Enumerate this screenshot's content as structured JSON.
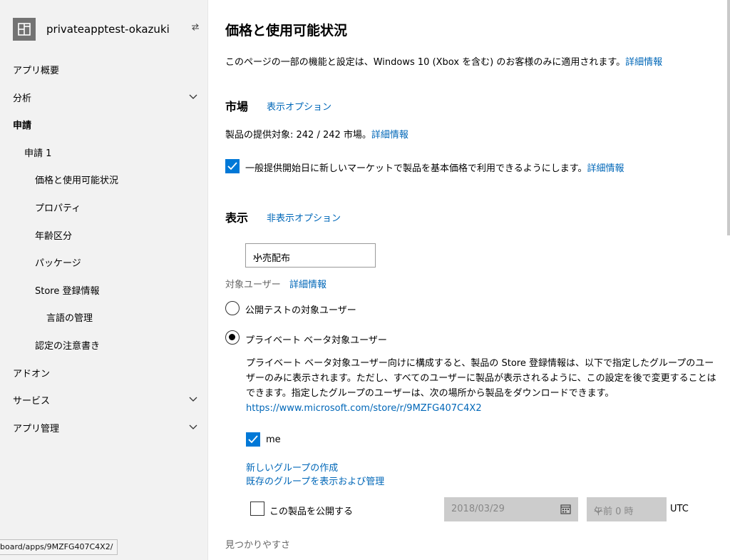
{
  "sidebar": {
    "app_name": "privateapptest-okazuki",
    "items": [
      {
        "label": "アプリ概要"
      },
      {
        "label": "分析"
      },
      {
        "label": "申請"
      },
      {
        "label": "申請 1"
      },
      {
        "label": "価格と使用可能状況"
      },
      {
        "label": "プロパティ"
      },
      {
        "label": "年齢区分"
      },
      {
        "label": "パッケージ"
      },
      {
        "label": "Store 登録情報"
      },
      {
        "label": "言語の管理"
      },
      {
        "label": "認定の注意書き"
      },
      {
        "label": "アドオン"
      },
      {
        "label": "サービス"
      },
      {
        "label": "アプリ管理"
      }
    ],
    "status_url": "board/apps/9MZFG407C4X2/"
  },
  "main": {
    "title": "価格と使用可能状況",
    "intro_text": "このページの一部の機能と設定は、Windows 10 (Xbox を含む) のお客様のみに適用されます。",
    "details_link": "詳細情報",
    "markets": {
      "title": "市場",
      "options_link": "表示オプション",
      "availability_text": "製品の提供対象: 242 / 242 市場。",
      "auto_checkbox_label": "一般提供開始日に新しいマーケットで製品を基本価格で利用できるようにします。",
      "auto_checked": true
    },
    "visibility": {
      "title": "表示",
      "hide_options_link": "非表示オプション",
      "distribution_value": "小売配布",
      "audience_label": "対象ユーザー",
      "public_beta_label": "公開テストの対象ユーザー",
      "private_beta_label": "プライベート ベータ対象ユーザー",
      "private_beta_desc": "プライベート ベータ対象ユーザー向けに構成すると、製品の Store 登録情報は、以下で指定したグループのユーザーのみに表示されます。ただし、すべてのユーザーに製品が表示されるように、この設定を後で変更することはできます。指定したグループのユーザーは、次の場所から製品をダウンロードできます。",
      "store_url": "https://www.microsoft.com/store/r/9MZFG407C4X2",
      "group_me_label": "me",
      "group_me_checked": true,
      "new_group_link": "新しいグループの作成",
      "manage_groups_link": "既存のグループを表示および管理",
      "publish_label": "この製品を公開する",
      "publish_checked": false,
      "date_value": "2018/03/29",
      "time_value": "午前 0 時",
      "timezone": "UTC"
    },
    "discoverability_title": "見つかりやすさ"
  }
}
